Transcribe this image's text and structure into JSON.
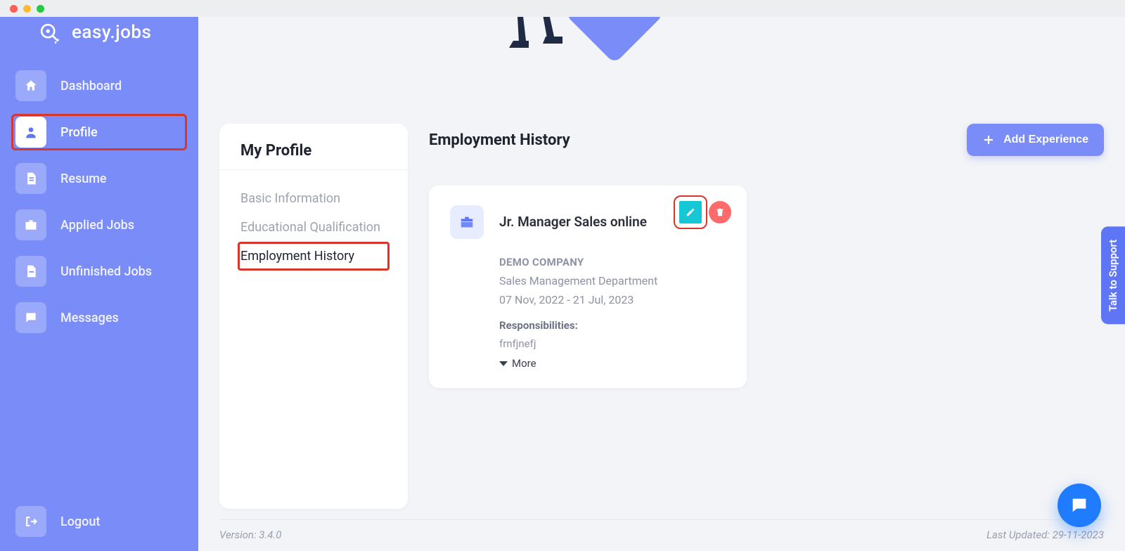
{
  "brand": {
    "name": "easy.jobs"
  },
  "sidebar": {
    "items": [
      {
        "label": "Dashboard"
      },
      {
        "label": "Profile"
      },
      {
        "label": "Resume"
      },
      {
        "label": "Applied Jobs"
      },
      {
        "label": "Unfinished Jobs"
      },
      {
        "label": "Messages"
      }
    ],
    "logout_label": "Logout"
  },
  "profile_menu": {
    "title": "My Profile",
    "items": [
      {
        "label": "Basic Information"
      },
      {
        "label": "Educational Qualification"
      },
      {
        "label": "Employment History"
      }
    ]
  },
  "section": {
    "title": "Employment History",
    "add_button": "Add Experience"
  },
  "experience": {
    "designation": "Jr. Manager Sales online",
    "company": "DEMO COMPANY",
    "department": "Sales Management Department",
    "date_range": "07 Nov, 2022 - 21 Jul, 2023",
    "responsibilities_label": "Responsibilities:",
    "responsibilities_text": "frnfjnefj",
    "more_label": "More"
  },
  "footer": {
    "version": "Version: 3.4.0",
    "last_updated": "Last Updated: 29-11-2023"
  },
  "support_tab": "Talk to Support"
}
